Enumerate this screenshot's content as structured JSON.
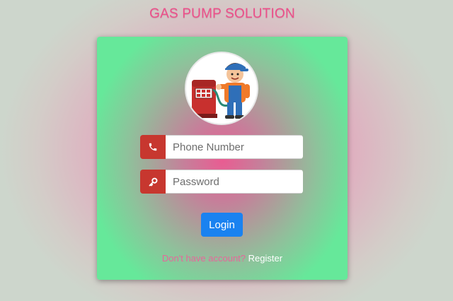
{
  "header": {
    "title": "GAS PUMP SOLUTION"
  },
  "avatar": {
    "icon": "gas-station-attendant-illustration"
  },
  "form": {
    "phone": {
      "icon": "phone-icon",
      "placeholder": "Phone Number",
      "value": ""
    },
    "password": {
      "icon": "key-icon",
      "placeholder": "Password",
      "value": ""
    },
    "login_label": "Login"
  },
  "footer": {
    "prompt": "Don't have account?",
    "register_label": "Register"
  },
  "colors": {
    "title": "#ec4f8a",
    "addon": "#c7372f",
    "button": "#1a82f0",
    "prompt": "#e6679a"
  }
}
